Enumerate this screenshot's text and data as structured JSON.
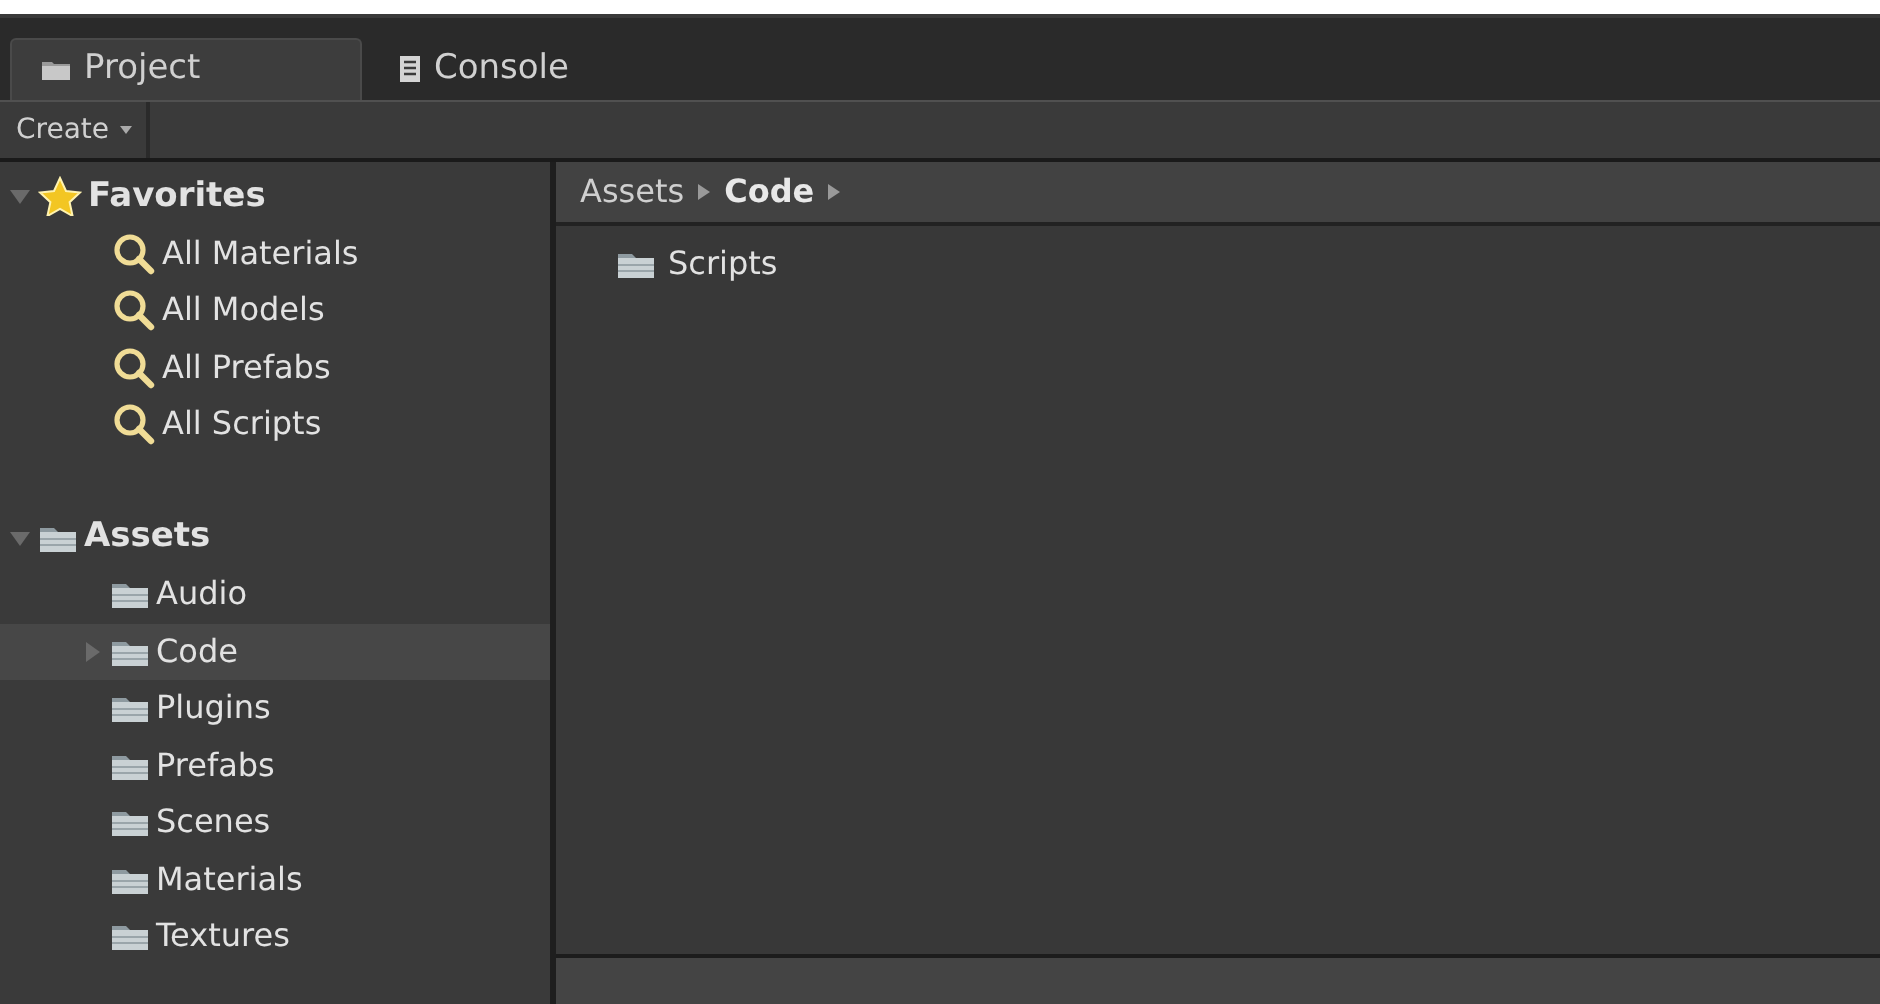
{
  "tabs": [
    {
      "label": "Project",
      "selected": true,
      "kind": "folder"
    },
    {
      "label": "Console",
      "selected": false,
      "kind": "console"
    }
  ],
  "toolbar": {
    "create_button": "Create"
  },
  "sidebar": {
    "favorites": {
      "label": "Favorites",
      "expanded": true,
      "items": [
        {
          "label": "All Materials"
        },
        {
          "label": "All Models"
        },
        {
          "label": "All Prefabs"
        },
        {
          "label": "All Scripts"
        }
      ]
    },
    "assets": {
      "label": "Assets",
      "expanded": true,
      "children": [
        {
          "label": "Audio",
          "selected": false,
          "expandable": false
        },
        {
          "label": "Code",
          "selected": true,
          "expandable": true
        },
        {
          "label": "Plugins",
          "selected": false,
          "expandable": false
        },
        {
          "label": "Prefabs",
          "selected": false,
          "expandable": false
        },
        {
          "label": "Scenes",
          "selected": false,
          "expandable": false
        },
        {
          "label": "Materials",
          "selected": false,
          "expandable": false
        },
        {
          "label": "Textures",
          "selected": false,
          "expandable": false
        }
      ]
    }
  },
  "breadcrumb": [
    {
      "label": "Assets",
      "selected": false
    },
    {
      "label": "Code",
      "selected": true
    }
  ],
  "content": {
    "items": [
      {
        "label": "Scripts"
      }
    ]
  }
}
